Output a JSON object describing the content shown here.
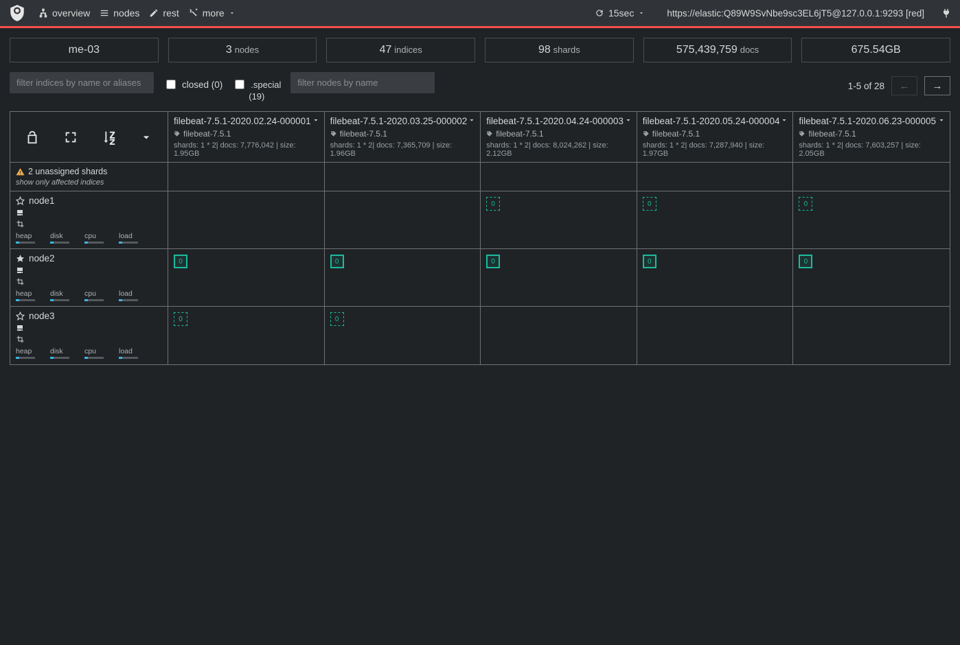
{
  "nav": {
    "overview": "overview",
    "nodes": "nodes",
    "rest": "rest",
    "more": "more",
    "refresh_interval": "15sec",
    "connection_string": "https://elastic:Q89W9SvNbe9sc3EL6jT5@127.0.0.1:9293 [red]"
  },
  "summary": {
    "cluster_name": "me-03",
    "nodes_count": "3",
    "nodes_label": "nodes",
    "indices_count": "47",
    "indices_label": "indices",
    "shards_count": "98",
    "shards_label": "shards",
    "docs_count": "575,439,759",
    "docs_label": "docs",
    "size": "675.54GB"
  },
  "filters": {
    "indices_placeholder": "filter indices by name or aliases",
    "closed_label": "closed (0)",
    "special_label": ".special",
    "special_count": "(19)",
    "nodes_placeholder": "filter nodes by name"
  },
  "pager": {
    "range_text": "1-5 of 28",
    "prev": "←",
    "next": "→"
  },
  "warning": {
    "text": "2 unassigned shards",
    "sub": "show only affected indices"
  },
  "indices": [
    {
      "name": "filebeat-7.5.1-2020.02.24-000001",
      "alias": "filebeat-7.5.1",
      "stats": "shards: 1 * 2| docs: 7,776,042 | size: 1.95GB"
    },
    {
      "name": "filebeat-7.5.1-2020.03.25-000002",
      "alias": "filebeat-7.5.1",
      "stats": "shards: 1 * 2| docs: 7,365,709 | size: 1.96GB"
    },
    {
      "name": "filebeat-7.5.1-2020.04.24-000003",
      "alias": "filebeat-7.5.1",
      "stats": "shards: 1 * 2| docs: 8,024,262 | size: 2.12GB"
    },
    {
      "name": "filebeat-7.5.1-2020.05.24-000004",
      "alias": "filebeat-7.5.1",
      "stats": "shards: 1 * 2| docs: 7,287,940 | size: 1.97GB"
    },
    {
      "name": "filebeat-7.5.1-2020.06.23-000005",
      "alias": "filebeat-7.5.1",
      "stats": "shards: 1 * 2| docs: 7,603,257 | size: 2.05GB"
    }
  ],
  "nodes": [
    {
      "name": "node1",
      "master": false,
      "metrics": [
        "heap",
        "disk",
        "cpu",
        "load"
      ]
    },
    {
      "name": "node2",
      "master": true,
      "metrics": [
        "heap",
        "disk",
        "cpu",
        "load"
      ]
    },
    {
      "name": "node3",
      "master": false,
      "metrics": [
        "heap",
        "disk",
        "cpu",
        "load"
      ]
    }
  ],
  "shard_label": "0",
  "allocation": [
    [
      null,
      null,
      "replica",
      "replica",
      "replica"
    ],
    [
      "primary",
      "primary",
      "primary",
      "primary",
      "primary"
    ],
    [
      "replica",
      "replica",
      null,
      null,
      null
    ]
  ]
}
